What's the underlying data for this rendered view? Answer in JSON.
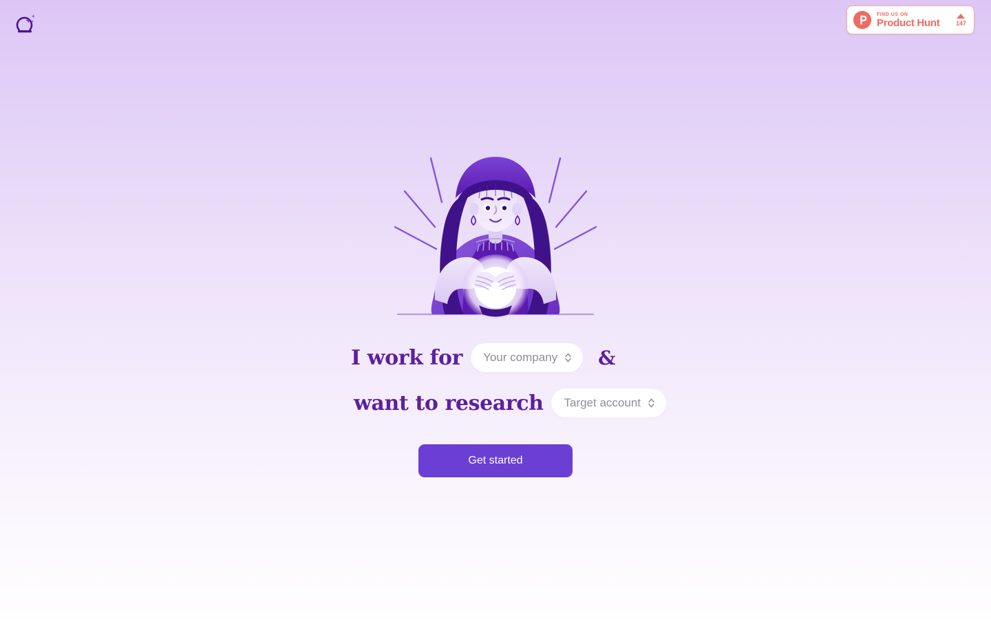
{
  "brand": {
    "logo_icon": "crystal-ball-sparkle-icon"
  },
  "product_hunt_badge": {
    "logo_icon": "product-hunt-p-icon",
    "find_us_on": "FIND US ON",
    "name": "Product Hunt",
    "upvote_icon": "upvote-triangle-icon",
    "upvote_count": "147",
    "accent_color": "#ef6a60"
  },
  "illustration": {
    "name": "fortune-teller-crystal-ball-illustration"
  },
  "hero": {
    "line1_prefix": "I work for",
    "line1_suffix": "&",
    "line2_prefix": "want to research",
    "company_select": {
      "placeholder": "Your company",
      "value": "",
      "chevron_icon": "chevron-up-down-icon"
    },
    "account_select": {
      "placeholder": "Target account",
      "value": "",
      "chevron_icon": "chevron-up-down-icon"
    },
    "text_color": "#5d1f9e"
  },
  "cta": {
    "label": "Get started",
    "background": "#6b3fd4",
    "text_color": "#ffffff"
  },
  "theme": {
    "bg_top": "#ddc6f6",
    "bg_bottom": "#fefdff"
  }
}
